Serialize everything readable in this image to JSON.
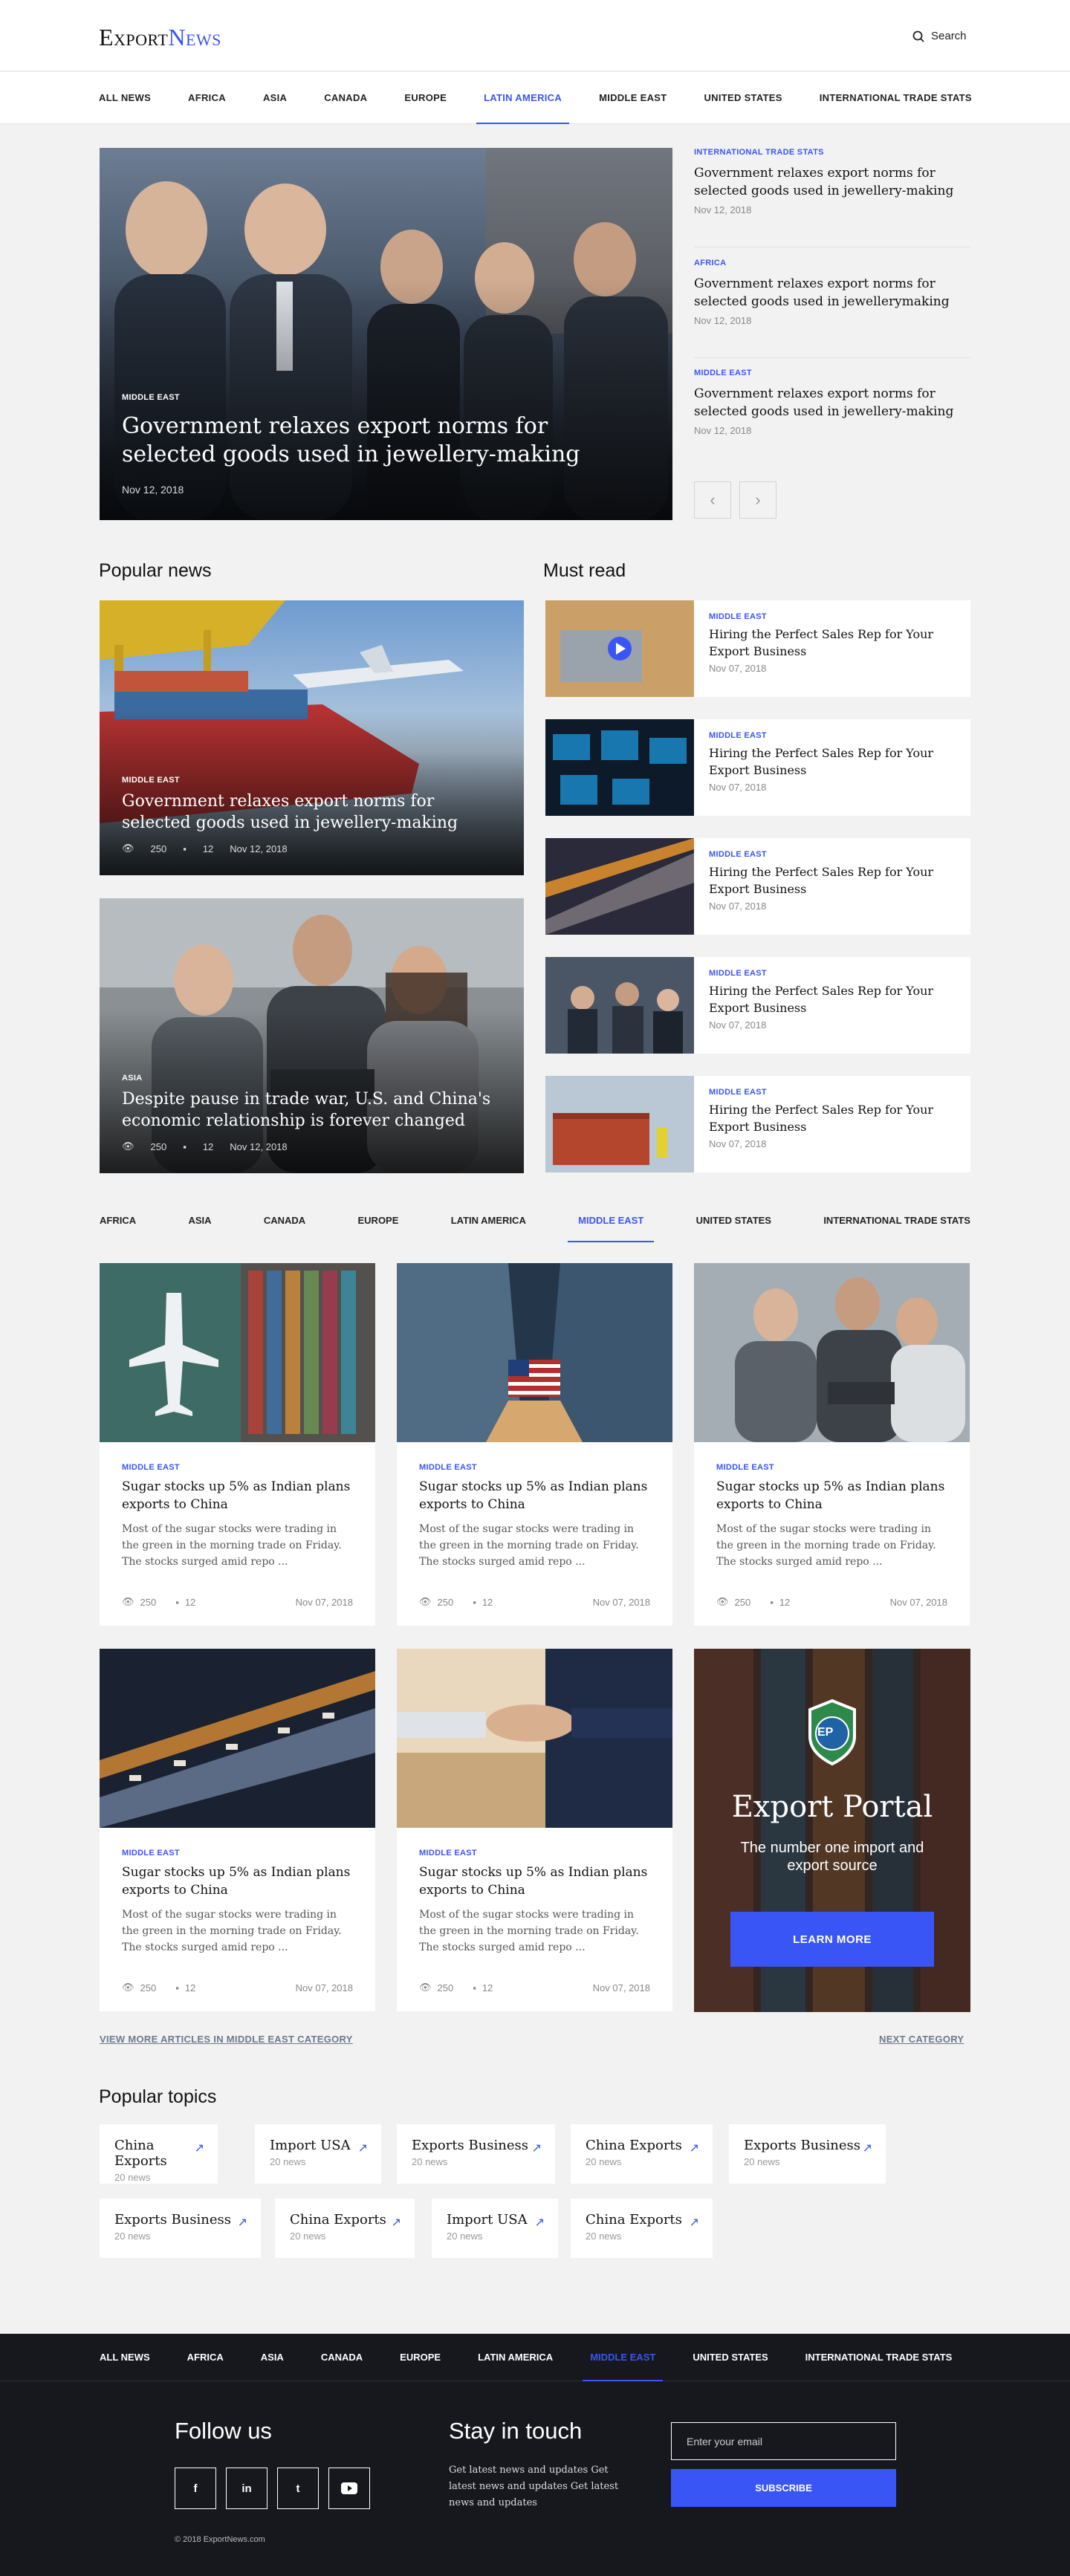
{
  "brand": {
    "logo_a": "Export",
    "logo_b": "News"
  },
  "header": {
    "search_label": "Search"
  },
  "nav": [
    "All News",
    "Africa",
    "Asia",
    "Canada",
    "Europe",
    "Latin America",
    "Middle East",
    "United States",
    "International Trade Stats"
  ],
  "nav_active": "Latin America",
  "hero": {
    "category": "Middle East",
    "title": "Government relaxes export norms for selected goods used in jewellery-making",
    "date": "Nov 12, 2018"
  },
  "side_headlines": [
    {
      "category": "International Trade Stats",
      "title": "Government relaxes export norms for selected goods used in jewellery-making",
      "date": "Nov 12, 2018"
    },
    {
      "category": "Africa",
      "title": "Government relaxes export norms for selected goods used in jewellerymaking",
      "date": "Nov 12, 2018"
    },
    {
      "category": "Middle East",
      "title": "Government relaxes export norms for selected goods used in jewellery-making",
      "date": "Nov 12, 2018"
    }
  ],
  "slider": {
    "prev": "‹",
    "next": "›"
  },
  "popular_news": {
    "title": "Popular news",
    "items": [
      {
        "category": "Middle East",
        "title": "Government relaxes export norms for selected goods used in jewellery-making",
        "views": "250",
        "comments": "12",
        "date": "Nov 12, 2018"
      },
      {
        "category": "Asia",
        "title": "Despite pause in trade war, U.S. and China's economic relationship is forever changed",
        "views": "250",
        "comments": "12",
        "date": "Nov 12, 2018"
      }
    ]
  },
  "must_read": {
    "title": "Must read",
    "items": [
      {
        "category": "Middle East",
        "title": "Hiring the Perfect Sales Rep for Your Export Business",
        "date": "Nov 07, 2018"
      },
      {
        "category": "Middle East",
        "title": "Hiring the Perfect Sales Rep for Your Export Business",
        "date": "Nov 07, 2018"
      },
      {
        "category": "Middle East",
        "title": "Hiring the Perfect Sales Rep for Your Export Business",
        "date": "Nov 07, 2018"
      },
      {
        "category": "Middle East",
        "title": "Hiring the Perfect Sales Rep for Your Export Business",
        "date": "Nov 07, 2018"
      },
      {
        "category": "Middle East",
        "title": "Hiring the Perfect Sales Rep for Your Export Business",
        "date": "Nov 07, 2018"
      }
    ]
  },
  "category_nav": [
    "Africa",
    "Asia",
    "Canada",
    "Europe",
    "Latin America",
    "Middle East",
    "United States",
    "International Trade Stats"
  ],
  "category_active": "Middle East",
  "articles": [
    {
      "category": "Middle East",
      "title": "Sugar stocks up 5% as Indian plans exports to China",
      "excerpt": "Most of the sugar stocks were trading in the green in the morning trade on Friday. The stocks surged amid repo ...",
      "views": "250",
      "comments": "12",
      "date": "Nov 07, 2018"
    },
    {
      "category": "Middle East",
      "title": "Sugar stocks up 5% as Indian plans exports to China",
      "excerpt": "Most of the sugar stocks were trading in the green in the morning trade on Friday. The stocks surged amid repo ...",
      "views": "250",
      "comments": "12",
      "date": "Nov 07, 2018"
    },
    {
      "category": "Middle East",
      "title": "Sugar stocks up 5% as Indian plans exports to China",
      "excerpt": "Most of the sugar stocks were trading in the green in the morning trade on Friday. The stocks surged amid repo ...",
      "views": "250",
      "comments": "12",
      "date": "Nov 07, 2018"
    },
    {
      "category": "Middle East",
      "title": "Sugar stocks up 5% as Indian plans exports to China",
      "excerpt": "Most of the sugar stocks were trading in the green in the morning trade on Friday. The stocks surged amid repo ...",
      "views": "250",
      "comments": "12",
      "date": "Nov 07, 2018"
    },
    {
      "category": "Middle East",
      "title": "Sugar stocks up 5% as Indian plans exports to China",
      "excerpt": "Most of the sugar stocks were trading in the green in the morning trade on Friday. The stocks surged amid repo ...",
      "views": "250",
      "comments": "12",
      "date": "Nov 07, 2018"
    }
  ],
  "promo": {
    "logo_text": "EP",
    "title": "Export Portal",
    "subtitle": "The number one import and export source",
    "button": "Learn More"
  },
  "links": {
    "view_more": "View more articles in Middle East category",
    "next": "Next category"
  },
  "topics": {
    "title": "Popular topics",
    "items": [
      {
        "name": "China Exports",
        "count": "20 news"
      },
      {
        "name": "Import USA",
        "count": "20 news"
      },
      {
        "name": "Exports Business",
        "count": "20 news"
      },
      {
        "name": "China Exports",
        "count": "20 news"
      },
      {
        "name": "Exports Business",
        "count": "20 news"
      },
      {
        "name": "Exports Business",
        "count": "20 news"
      },
      {
        "name": "China Exports",
        "count": "20 news"
      },
      {
        "name": "Import USA",
        "count": "20 news"
      },
      {
        "name": "China Exports",
        "count": "20 news"
      }
    ]
  },
  "footer": {
    "nav_active": "Middle East",
    "follow_title": "Follow us",
    "social": [
      "f",
      "in",
      "t",
      "yt"
    ],
    "stay_title": "Stay in touch",
    "stay_text": "Get latest news and updates Get latest news and updates Get latest news and updates",
    "email_placeholder": "Enter your email",
    "subscribe": "Subscribe",
    "copyright": "© 2018 ExportNews.com"
  },
  "colors": {
    "accent": "#3a55f5",
    "footer_bg": "#16181d",
    "page_bg": "#f2f2f2"
  }
}
